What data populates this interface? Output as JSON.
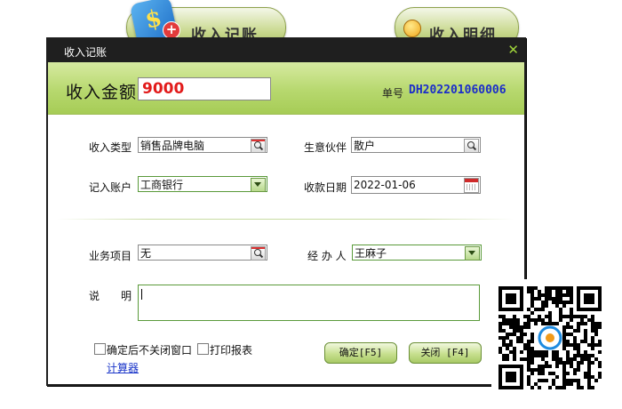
{
  "background": {
    "income_button_label": "收入记账",
    "detail_button_label": "收入明细"
  },
  "dialog": {
    "title": "收入记账",
    "header": {
      "amount_label": "收入金额",
      "amount_value": "9000",
      "doc_no_label": "单号",
      "doc_no": "DH202201060006"
    },
    "fields": {
      "income_type_label": "收入类型",
      "income_type_value": "销售品牌电脑",
      "partner_label": "生意伙伴",
      "partner_value": "散户",
      "account_label": "记入账户",
      "account_value": "工商银行",
      "date_label": "收款日期",
      "date_value": "2022-01-06",
      "project_label": "业务项目",
      "project_value": "无",
      "handler_label": "经 办 人",
      "handler_value": "王麻子",
      "desc_label": "说　　明",
      "desc_value": ""
    },
    "options": {
      "keep_open_label": "确定后不关闭窗口",
      "keep_open_checked": false,
      "print_label": "打印报表",
      "print_checked": false,
      "calculator_link": "计算器"
    },
    "buttons": {
      "ok_label": "确定[F5]",
      "close_label": "关闭 [F4]"
    }
  },
  "colors": {
    "header_green": "#b7d86e",
    "amount_red": "#e21b1b",
    "doc_no_blue": "#1b2ec9",
    "titlebar": "#1f1f1f"
  }
}
